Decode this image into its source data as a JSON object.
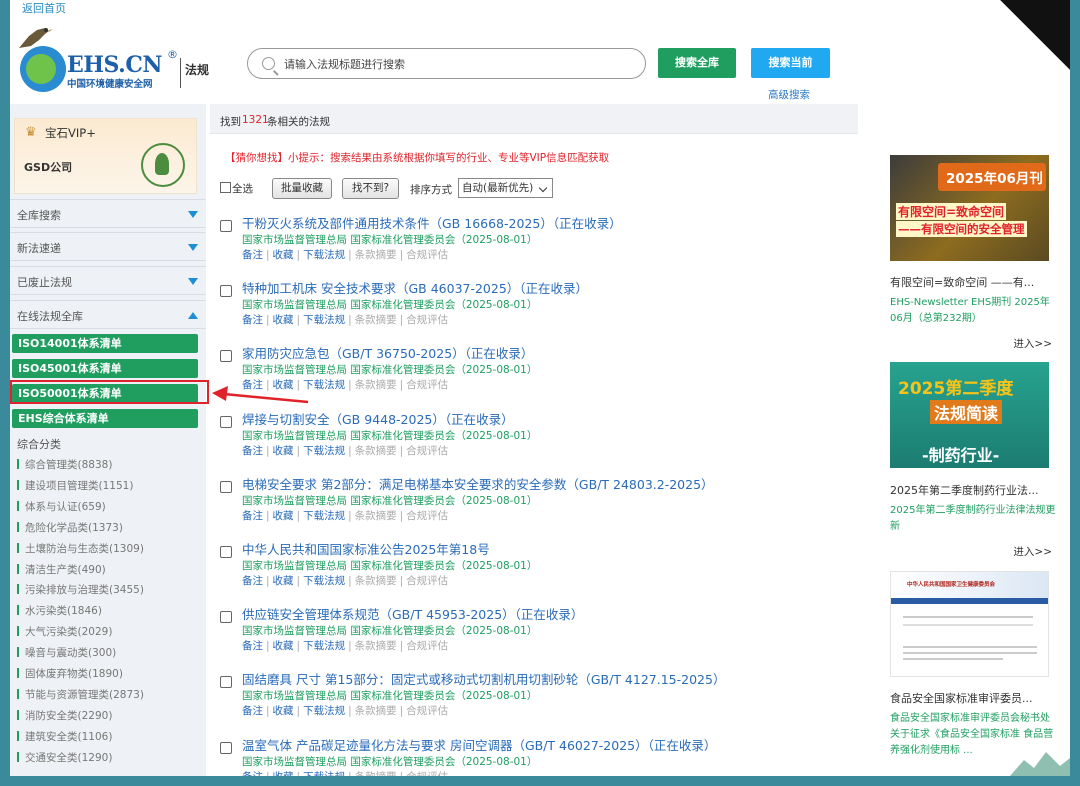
{
  "top_link": "返回首页",
  "logo": {
    "brand": "EHS.CN",
    "reg": "®",
    "sub": "中国环境健康安全网",
    "section": "法规"
  },
  "search": {
    "placeholder": "请输入法规标题进行搜索",
    "btn_all": "搜索全库",
    "btn_current": "搜索当前",
    "advanced": "高级搜索"
  },
  "sidebar": {
    "vip_label": "宝石VIP+",
    "company": "GSD公司",
    "accordions": [
      {
        "label": "全库搜索",
        "state": "collapsed"
      },
      {
        "label": "新法速递",
        "state": "collapsed"
      },
      {
        "label": "已废止法规",
        "state": "collapsed"
      },
      {
        "label": "在线法规全库",
        "state": "expanded"
      }
    ],
    "system_lists": [
      "ISO14001体系清单",
      "ISO45001体系清单",
      "ISO50001体系清单",
      "EHS综合体系清单"
    ],
    "highlighted": "ISO50001体系清单",
    "categories_title": "综合分类",
    "categories": [
      "综合管理类(8838)",
      "建设项目管理类(1151)",
      "体系与认证(659)",
      "危险化学品类(1373)",
      "土壤防治与生态类(1309)",
      "清洁生产类(490)",
      "污染排放与治理类(3455)",
      "水污染类(1846)",
      "大气污染类(2029)",
      "噪音与震动类(300)",
      "固体废弃物类(1890)",
      "节能与资源管理类(2873)",
      "消防安全类(2290)",
      "建筑安全类(1106)",
      "交通安全类(1290)"
    ]
  },
  "results": {
    "found_prefix": "找到",
    "count": "1321",
    "found_suffix": "条相关的法规",
    "tip_prefix": "【猜你想找】",
    "tip_text": "小提示：搜索结果由系统根据你填写的行业、专业等VIP信息匹配获取",
    "select_all": "全选",
    "batch_save": "批量收藏",
    "not_found": "找不到?",
    "sort_label": "排序方式",
    "sort_value": "自动(最新优先)",
    "ops": {
      "note": "备注",
      "save": "收藏",
      "download": "下载法规",
      "summary": "条款摘要",
      "compliance": "合规评估"
    },
    "items": [
      {
        "title": "干粉灭火系统及部件通用技术条件（GB 16668-2025）（正在收录）",
        "meta": "国家市场监督管理总局 国家标准化管理委员会（2025-08-01）"
      },
      {
        "title": "特种加工机床 安全技术要求（GB 46037-2025）（正在收录）",
        "meta": "国家市场监督管理总局 国家标准化管理委员会（2025-08-01）"
      },
      {
        "title": "家用防灾应急包（GB/T 36750-2025）（正在收录）",
        "meta": "国家市场监督管理总局 国家标准化管理委员会（2025-08-01）"
      },
      {
        "title": "焊接与切割安全（GB 9448-2025）（正在收录）",
        "meta": "国家市场监督管理总局 国家标准化管理委员会（2025-08-01）"
      },
      {
        "title": "电梯安全要求 第2部分：满足电梯基本安全要求的安全参数（GB/T 24803.2-2025）",
        "meta": "国家市场监督管理总局 国家标准化管理委员会（2025-08-01）"
      },
      {
        "title": "中华人民共和国国家标准公告2025年第18号",
        "meta": "国家市场监督管理总局 国家标准化管理委员会（2025-08-01）"
      },
      {
        "title": "供应链安全管理体系规范（GB/T 45953-2025）（正在收录）",
        "meta": "国家市场监督管理总局 国家标准化管理委员会（2025-08-01）"
      },
      {
        "title": "固结磨具 尺寸 第15部分：固定式或移动式切割机用切割砂轮（GB/T 4127.15-2025）",
        "meta": "国家市场监督管理总局 国家标准化管理委员会（2025-08-01）"
      },
      {
        "title": "温室气体 产品碳足迹量化方法与要求 房间空调器（GB/T 46027-2025）（正在收录）",
        "meta": "国家市场监督管理总局 国家标准化管理委员会（2025-08-01）"
      }
    ]
  },
  "right": {
    "cards": [
      {
        "img_title": "2025年06月刊",
        "img_line1": "有限空间=致命空间",
        "img_line2": "——有限空间的安全管理",
        "caption": "有限空间=致命空间 ——有...",
        "desc": "EHS-Newsletter EHS期刊 2025年06月（总第232期）",
        "more": "进入>>"
      },
      {
        "img_title": "2025第二季度",
        "img_line1": "法规简读",
        "img_line2": "-制药行业-",
        "caption": "2025年第二季度制药行业法...",
        "desc": "2025年第二季度制药行业法律法规更新",
        "more": "进入>>"
      },
      {
        "img_title": "中华人民共和国国家卫生健康委员会",
        "caption": "食品安全国家标准审评委员...",
        "desc": "食品安全国家标准审评委员会秘书处关于征求《食品安全国家标准 食品营养强化剂使用标 ..."
      }
    ]
  },
  "colors": {
    "green": "#1f9e60",
    "blue": "#20a8f0",
    "red": "#e0232a",
    "link": "#2a6bb8",
    "frame": "#3b8a9c"
  }
}
